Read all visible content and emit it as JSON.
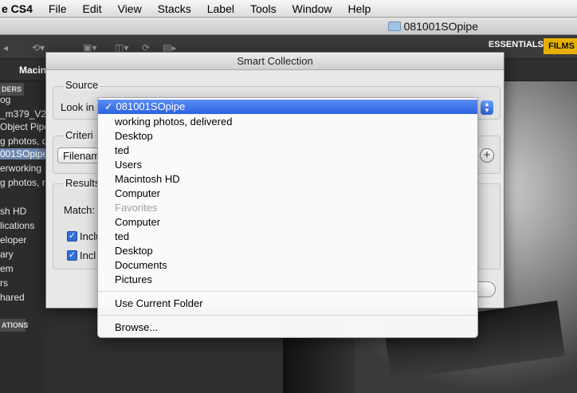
{
  "menubar": {
    "app_name": "e CS4",
    "items": [
      "File",
      "Edit",
      "View",
      "Stacks",
      "Label",
      "Tools",
      "Window",
      "Help"
    ]
  },
  "window": {
    "title": "081001SOpipe"
  },
  "toolbar": {
    "workspace_essentials": "ESSENTIALS",
    "workspace_films": "FILMS"
  },
  "pathbar": {
    "text": "Macin"
  },
  "left_panel": {
    "tab": "DERS",
    "items": [
      {
        "label": "og",
        "selected": false
      },
      {
        "label": "_m379_V2",
        "selected": false
      },
      {
        "label": "Object Pipe",
        "selected": false
      },
      {
        "label": "g photos, d",
        "selected": false
      },
      {
        "label": "001SOpipe",
        "selected": true
      },
      {
        "label": "erworking",
        "selected": false
      },
      {
        "label": "g photos, r",
        "selected": false
      },
      {
        "label": "",
        "selected": false
      },
      {
        "label": "sh HD",
        "selected": false
      },
      {
        "label": "lications",
        "selected": false
      },
      {
        "label": "eloper",
        "selected": false
      },
      {
        "label": "ary",
        "selected": false
      },
      {
        "label": "em",
        "selected": false
      },
      {
        "label": "rs",
        "selected": false
      },
      {
        "label": "hared",
        "selected": false
      }
    ],
    "tab2": "ATIONS"
  },
  "dialog": {
    "title": "Smart Collection",
    "source_label": "Source",
    "look_in_label": "Look in",
    "criteria_label": "Criteri",
    "criteria_field_value": "Filenam",
    "results_label": "Results",
    "match_label": "Match:",
    "include_1_label": "Inclu",
    "include_2_label": "Incl",
    "include_1_checked": true,
    "include_2_checked": true
  },
  "look_in_menu": {
    "selected": "081001SOpipe",
    "items": [
      {
        "label": "081001SOpipe",
        "state": "selected"
      },
      {
        "label": "working photos, delivered",
        "state": "normal"
      },
      {
        "label": "Desktop",
        "state": "normal"
      },
      {
        "label": "ted",
        "state": "normal"
      },
      {
        "label": "Users",
        "state": "normal"
      },
      {
        "label": "Macintosh HD",
        "state": "normal"
      },
      {
        "label": "Computer",
        "state": "normal"
      },
      {
        "label": "Favorites",
        "state": "disabled"
      },
      {
        "label": "Computer",
        "state": "normal"
      },
      {
        "label": "ted",
        "state": "normal"
      },
      {
        "label": "Desktop",
        "state": "normal"
      },
      {
        "label": "Documents",
        "state": "normal"
      },
      {
        "label": "Pictures",
        "state": "normal"
      }
    ],
    "use_current_folder": "Use Current Folder",
    "browse": "Browse..."
  },
  "colors": {
    "menu_selection": "#2b62e0",
    "workspace_accent": "#e7b000",
    "folder_selection": "#6d87ad"
  },
  "icons": [
    "folder-icon",
    "checkmark-icon",
    "plus-icon",
    "stepper-icon"
  ]
}
